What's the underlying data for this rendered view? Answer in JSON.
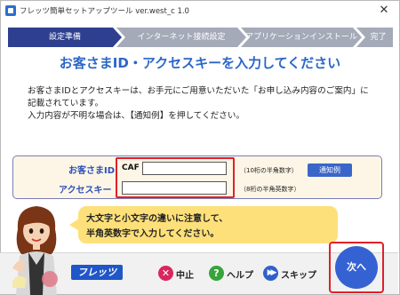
{
  "window": {
    "title": "フレッツ簡単セットアップツール ver.west_c 1.0",
    "close_label": "✕"
  },
  "steps": [
    {
      "label": "設定準備",
      "state": "active"
    },
    {
      "label": "インターネット接続設定",
      "state": "inactive"
    },
    {
      "label": "アプリケーションインストール",
      "state": "inactive"
    },
    {
      "label": "完了",
      "state": "inactive"
    }
  ],
  "heading": "お客さまID・アクセスキーを入力してください",
  "instructions": {
    "line1": "お客さまIDとアクセスキーは、お手元にご用意いただいた「お申し込み内容のご案内」に",
    "line2": "記載されています。",
    "line3": "入力内容が不明な場合は、【通知例】を押してください。"
  },
  "form": {
    "customer_id_label": "お客さまID",
    "customer_id_prefix": "CAF",
    "customer_id_value": "",
    "customer_id_hint": "（10桁の半角数字）",
    "access_key_label": "アクセスキー",
    "access_key_value": "",
    "access_key_hint": "（8桁の半角英数字）",
    "sample_button": "通知例"
  },
  "bubble": {
    "line1": "大文字と小文字の違いに注意して、",
    "line2": "半角英数字で入力してください。"
  },
  "footer": {
    "logo_text": "フレッツ",
    "stop_label": "中止",
    "help_label": "ヘルプ",
    "skip_label": "スキップ",
    "next_label": "次へ"
  },
  "colors": {
    "accent": "#2e3f8f",
    "heading": "#2b67c8",
    "highlight": "#e0202a",
    "bubble": "#fde07a",
    "form_bg": "#fdf6e6"
  }
}
